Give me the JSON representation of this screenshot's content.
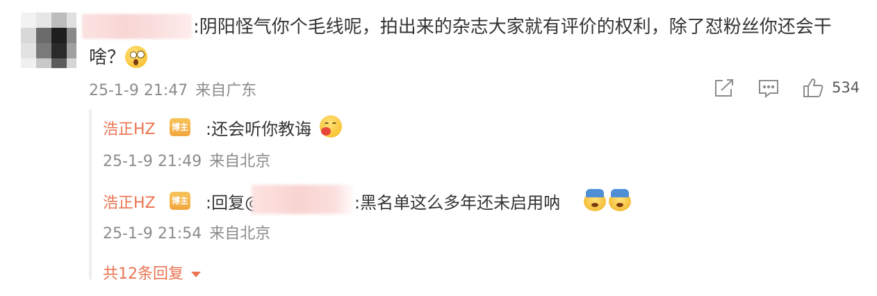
{
  "comment": {
    "text_line1": ":阴阳怪气你个毛线呢，拍出来的杂志大家就有评价的权利，除了怼粉丝你还会干",
    "text_line2": "啥？",
    "timestamp": "25-1-9 21:47",
    "location": "来自广东",
    "like_count": "534",
    "icons": [
      "share-icon",
      "comment-icon",
      "like-icon"
    ]
  },
  "replies": [
    {
      "user": "浩正HZ",
      "badge": "博主",
      "text": ":还会听你教诲",
      "timestamp": "25-1-9 21:49",
      "location": "来自北京"
    },
    {
      "user": "浩正HZ",
      "badge": "博主",
      "text_prefix": ":回复@",
      "text": ":黑名单这么多年还未启用呐",
      "timestamp": "25-1-9 21:54",
      "location": "来自北京"
    }
  ],
  "more_replies": "共12条回复",
  "colors": {
    "username": "#eb7350",
    "meta": "#8b8b8b",
    "text": "#333333",
    "badge": "#f0a63c"
  }
}
